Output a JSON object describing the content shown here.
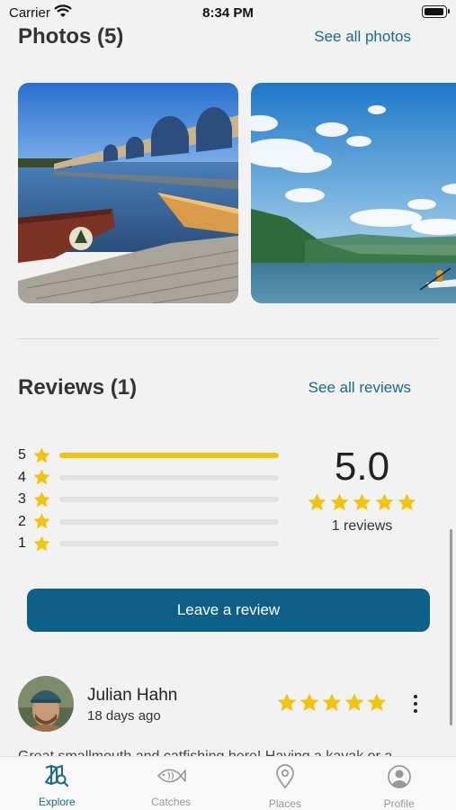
{
  "status": {
    "carrier": "Carrier",
    "time": "8:34 PM"
  },
  "photos": {
    "title": "Photos (5)",
    "see_all": "See all photos"
  },
  "reviews": {
    "title": "Reviews (1)",
    "see_all": "See all reviews",
    "breakdown": [
      {
        "stars": "5",
        "fraction": 1.0
      },
      {
        "stars": "4",
        "fraction": 0
      },
      {
        "stars": "3",
        "fraction": 0
      },
      {
        "stars": "2",
        "fraction": 0
      },
      {
        "stars": "1",
        "fraction": 0
      }
    ],
    "average": "5.0",
    "count_text": "1 reviews",
    "leave_review": "Leave a review"
  },
  "review": {
    "name": "Julian Hahn",
    "date": "18 days ago",
    "rating": 5,
    "text": "Great smallmouth and catfishing here! Having a kayak or a"
  },
  "tabs": [
    {
      "label": "Explore",
      "icon": "map-search-icon",
      "active": true
    },
    {
      "label": "Catches",
      "icon": "fish-icon",
      "active": false
    },
    {
      "label": "Places",
      "icon": "location-pin-icon",
      "active": false
    },
    {
      "label": "Profile",
      "icon": "person-circle-icon",
      "active": false
    }
  ],
  "colors": {
    "accent": "#0e6088",
    "star": "#f1c40f",
    "link": "#1a6a8a"
  }
}
